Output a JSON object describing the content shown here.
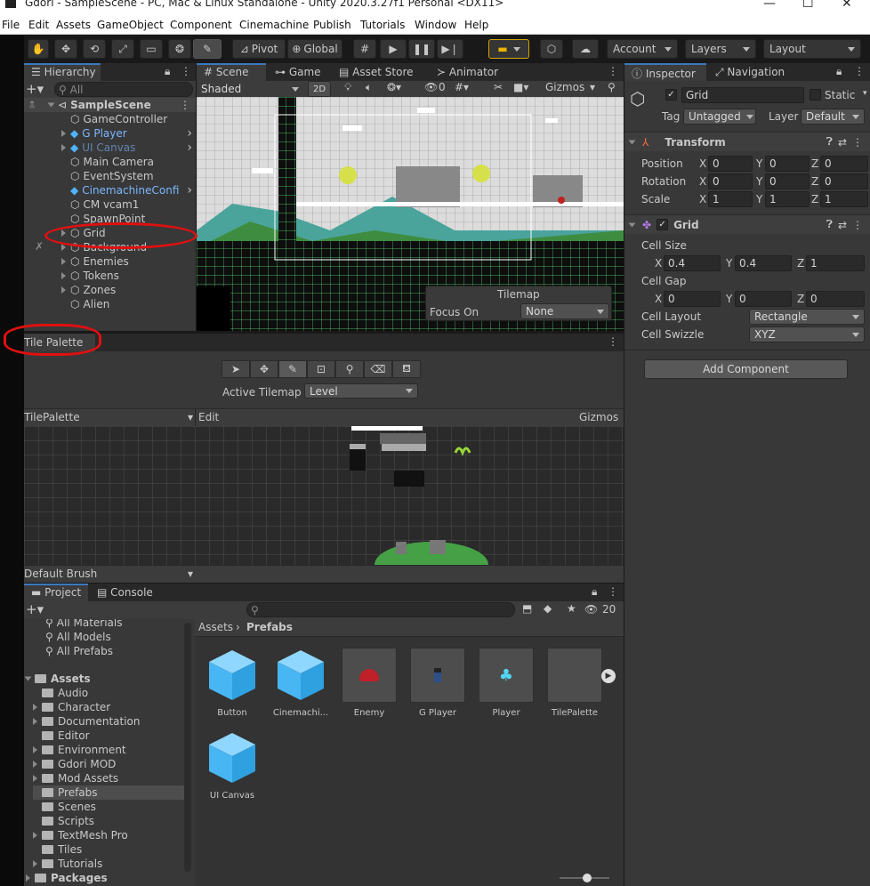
{
  "window": {
    "title": "Gdori - SampleScene - PC, Mac & Linux Standalone - Unity 2020.3.27f1 Personal <DX11>"
  },
  "menu": [
    "File",
    "Edit",
    "Assets",
    "GameObject",
    "Component",
    "Cinemachine",
    "Publish",
    "Tutorials",
    "Window",
    "Help"
  ],
  "toolbar": {
    "pivot": "Pivot",
    "global": "Global",
    "account": "Account",
    "layers": "Layers",
    "layout": "Layout"
  },
  "hierarchy": {
    "tab": "Hierarchy",
    "search_placeholder": "All",
    "scene": "SampleScene",
    "items": [
      {
        "label": "GameController",
        "kind": "normal"
      },
      {
        "label": "G Player",
        "kind": "prefab"
      },
      {
        "label": "UI Canvas",
        "kind": "prefab-dim"
      },
      {
        "label": "Main Camera",
        "kind": "normal"
      },
      {
        "label": "EventSystem",
        "kind": "normal"
      },
      {
        "label": "CinemachineConfi",
        "kind": "prefab"
      },
      {
        "label": "CM vcam1",
        "kind": "normal"
      },
      {
        "label": "SpawnPoint",
        "kind": "normal"
      },
      {
        "label": "Grid",
        "kind": "normal"
      },
      {
        "label": "Background",
        "kind": "normal"
      },
      {
        "label": "Enemies",
        "kind": "normal"
      },
      {
        "label": "Tokens",
        "kind": "normal"
      },
      {
        "label": "Zones",
        "kind": "normal"
      },
      {
        "label": "Alien",
        "kind": "normal"
      }
    ]
  },
  "scene_tabs": {
    "scene": "Scene",
    "game": "Game",
    "asset_store": "Asset Store",
    "animator": "Animator"
  },
  "scene_toolbar": {
    "shading": "Shaded",
    "mode2d": "2D",
    "hidden_count": "0",
    "gizmos": "Gizmos"
  },
  "tilemap_overlay": {
    "title": "Tilemap",
    "focus_label": "Focus On",
    "focus_value": "None"
  },
  "tile_palette": {
    "tab": "Tile Palette",
    "active_label": "Active Tilemap",
    "active_value": "Level",
    "palette": "TilePalette",
    "edit": "Edit",
    "gizmos": "Gizmos",
    "brush": "Default Brush"
  },
  "project": {
    "tab": "Project",
    "console_tab": "Console",
    "hidden_count": "20",
    "favorites": [
      "All Materials",
      "All Models",
      "All Prefabs"
    ],
    "root": "Assets",
    "folders": [
      "Audio",
      "Character",
      "Documentation",
      "Editor",
      "Environment",
      "Gdori MOD",
      "Mod Assets",
      "Prefabs",
      "Scenes",
      "Scripts",
      "TextMesh Pro",
      "Tiles",
      "Tutorials"
    ],
    "packages": "Packages",
    "breadcrumb": [
      "Assets",
      "Prefabs"
    ],
    "assets": [
      "Button",
      "Cinemachi...",
      "Enemy",
      "G Player",
      "Player",
      "TilePalette",
      "UI Canvas"
    ]
  },
  "inspector": {
    "tab": "Inspector",
    "nav_tab": "Navigation",
    "name": "Grid",
    "static": "Static",
    "tag_label": "Tag",
    "tag": "Untagged",
    "layer_label": "Layer",
    "layer": "Default",
    "transform": {
      "title": "Transform",
      "position": {
        "label": "Position",
        "x": "0",
        "y": "0",
        "z": "0"
      },
      "rotation": {
        "label": "Rotation",
        "x": "0",
        "y": "0",
        "z": "0"
      },
      "scale": {
        "label": "Scale",
        "x": "1",
        "y": "1",
        "z": "1"
      }
    },
    "grid": {
      "title": "Grid",
      "cell_size_label": "Cell Size",
      "cell_size": {
        "x": "0.4",
        "y": "0.4",
        "z": "1"
      },
      "cell_gap_label": "Cell Gap",
      "cell_gap": {
        "x": "0",
        "y": "0",
        "z": "0"
      },
      "layout_label": "Cell Layout",
      "layout": "Rectangle",
      "swizzle_label": "Cell Swizzle",
      "swizzle": "XYZ"
    },
    "add_component": "Add Component"
  },
  "axis_labels": {
    "x": "X",
    "y": "Y",
    "z": "Z"
  },
  "colors": {
    "accent": "#3a79bb",
    "annotation": "#e01010",
    "prefab": "#7bb7ff"
  }
}
